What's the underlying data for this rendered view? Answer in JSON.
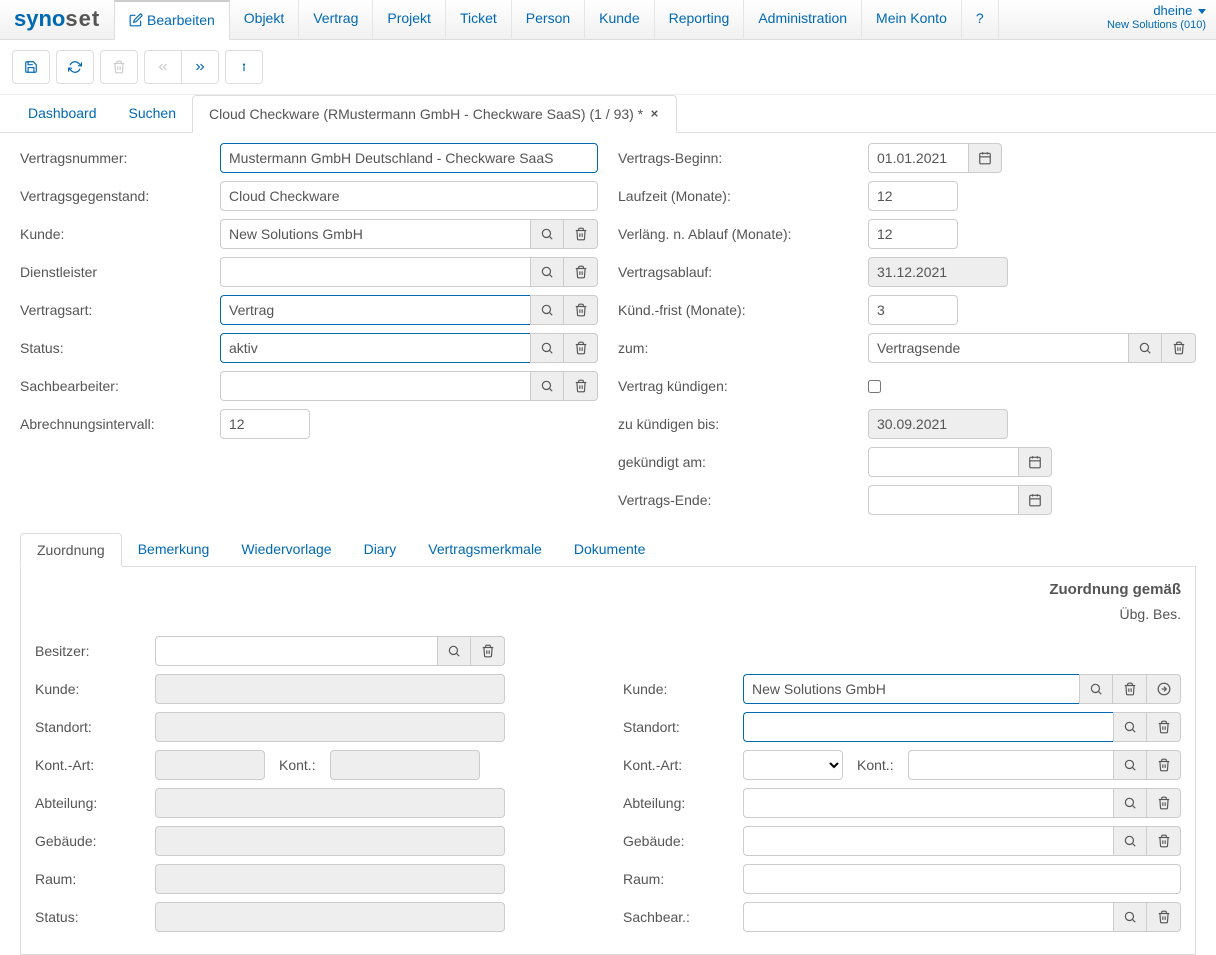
{
  "brand": {
    "p1": "syno",
    "p2": "set"
  },
  "nav": [
    "Bearbeiten",
    "Objekt",
    "Vertrag",
    "Projekt",
    "Ticket",
    "Person",
    "Kunde",
    "Reporting",
    "Administration",
    "Mein Konto",
    "?"
  ],
  "user": {
    "name": "dheine",
    "org": "New Solutions (010)"
  },
  "subtabs": {
    "dashboard": "Dashboard",
    "search": "Suchen",
    "current": "Cloud Checkware (RMustermann GmbH - Checkware SaaS) (1 / 93) *"
  },
  "left": {
    "vertragsnummer_l": "Vertragsnummer:",
    "vertragsnummer": "Mustermann GmbH Deutschland - Checkware SaaS",
    "gegenstand_l": "Vertragsgegenstand:",
    "gegenstand": "Cloud Checkware",
    "kunde_l": "Kunde:",
    "kunde": "New Solutions GmbH",
    "dienstleister_l": "Dienstleister",
    "dienstleister": "",
    "vertragsart_l": "Vertragsart:",
    "vertragsart": "Vertrag",
    "status_l": "Status:",
    "status": "aktiv",
    "sachbearbeiter_l": "Sachbearbeiter:",
    "sachbearbeiter": "",
    "intervall_l": "Abrechnungsintervall:",
    "intervall": "12"
  },
  "right": {
    "beginn_l": "Vertrags-Beginn:",
    "beginn": "01.01.2021",
    "laufzeit_l": "Laufzeit (Monate):",
    "laufzeit": "12",
    "verlaeng_l": "Verläng. n. Ablauf (Monate):",
    "verlaeng": "12",
    "ablauf_l": "Vertragsablauf:",
    "ablauf": "31.12.2021",
    "kfrist_l": "Künd.-frist (Monate):",
    "kfrist": "3",
    "zum_l": "zum:",
    "zum": "Vertragsende",
    "kuendigen_l": "Vertrag kündigen:",
    "zukbis_l": "zu kündigen bis:",
    "zukbis": "30.09.2021",
    "gekam_l": "gekündigt am:",
    "gekam": "",
    "ende_l": "Vertrags-Ende:",
    "ende": ""
  },
  "innerTabs": [
    "Zuordnung",
    "Bemerkung",
    "Wiedervorlage",
    "Diary",
    "Vertragsmerkmale",
    "Dokumente"
  ],
  "panel": {
    "hdr": "Zuordnung gemäß",
    "sub": "Übg. Bes.",
    "left": {
      "besitzer_l": "Besitzer:",
      "kunde_l": "Kunde:",
      "standort_l": "Standort:",
      "kontart_l": "Kont.-Art:",
      "kont_l": "Kont.:",
      "abteilung_l": "Abteilung:",
      "gebaeude_l": "Gebäude:",
      "raum_l": "Raum:",
      "status_l": "Status:"
    },
    "right": {
      "kunde_l": "Kunde:",
      "kunde": "New Solutions GmbH",
      "standort_l": "Standort:",
      "kontart_l": "Kont.-Art:",
      "kont_l": "Kont.:",
      "abteilung_l": "Abteilung:",
      "gebaeude_l": "Gebäude:",
      "raum_l": "Raum:",
      "sachbear_l": "Sachbear.:"
    }
  }
}
